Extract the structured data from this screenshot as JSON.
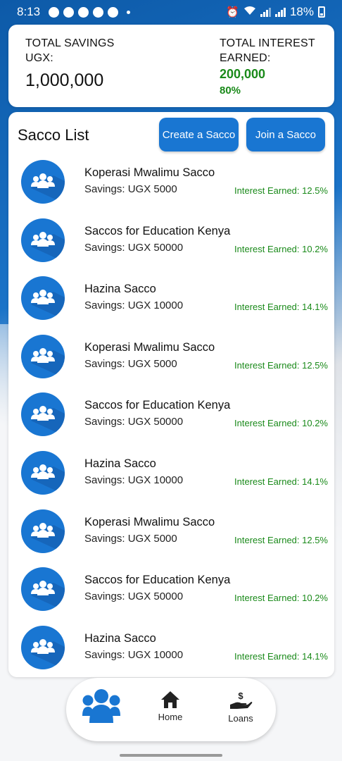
{
  "status_bar": {
    "time": "8:13",
    "battery": "18%"
  },
  "summary": {
    "savings_label": "TOTAL SAVINGS UGX:",
    "savings_value": "1,000,000",
    "interest_label": "TOTAL INTEREST EARNED:",
    "interest_value": "200,000",
    "interest_pct": "80%"
  },
  "list": {
    "title": "Sacco List",
    "create_label": "Create a Sacco",
    "join_label": "Join a Sacco",
    "items": [
      {
        "name": "Koperasi Mwalimu Sacco",
        "savings": "Savings: UGX 5000",
        "interest": "Interest Earned: 12.5%"
      },
      {
        "name": "Saccos for Education Kenya",
        "savings": "Savings: UGX 50000",
        "interest": "Interest Earned: 10.2%"
      },
      {
        "name": "Hazina Sacco",
        "savings": "Savings: UGX 10000",
        "interest": "Interest Earned: 14.1%"
      },
      {
        "name": "Koperasi Mwalimu Sacco",
        "savings": "Savings: UGX 5000",
        "interest": "Interest Earned: 12.5%"
      },
      {
        "name": "Saccos for Education Kenya",
        "savings": "Savings: UGX 50000",
        "interest": "Interest Earned: 10.2%"
      },
      {
        "name": "Hazina Sacco",
        "savings": "Savings: UGX 10000",
        "interest": "Interest Earned: 14.1%"
      },
      {
        "name": "Koperasi Mwalimu Sacco",
        "savings": "Savings: UGX 5000",
        "interest": "Interest Earned: 12.5%"
      },
      {
        "name": "Saccos for Education Kenya",
        "savings": "Savings: UGX 50000",
        "interest": "Interest Earned: 10.2%"
      },
      {
        "name": "Hazina Sacco",
        "savings": "Savings: UGX 10000",
        "interest": "Interest Earned: 14.1%"
      }
    ]
  },
  "nav": {
    "home_label": "Home",
    "loans_label": "Loans"
  },
  "colors": {
    "accent": "#1976d2",
    "interest_green": "#1a8a1a"
  },
  "icons": {
    "sacco": "group-icon",
    "home": "home-icon",
    "loans": "loan-hand-icon"
  }
}
